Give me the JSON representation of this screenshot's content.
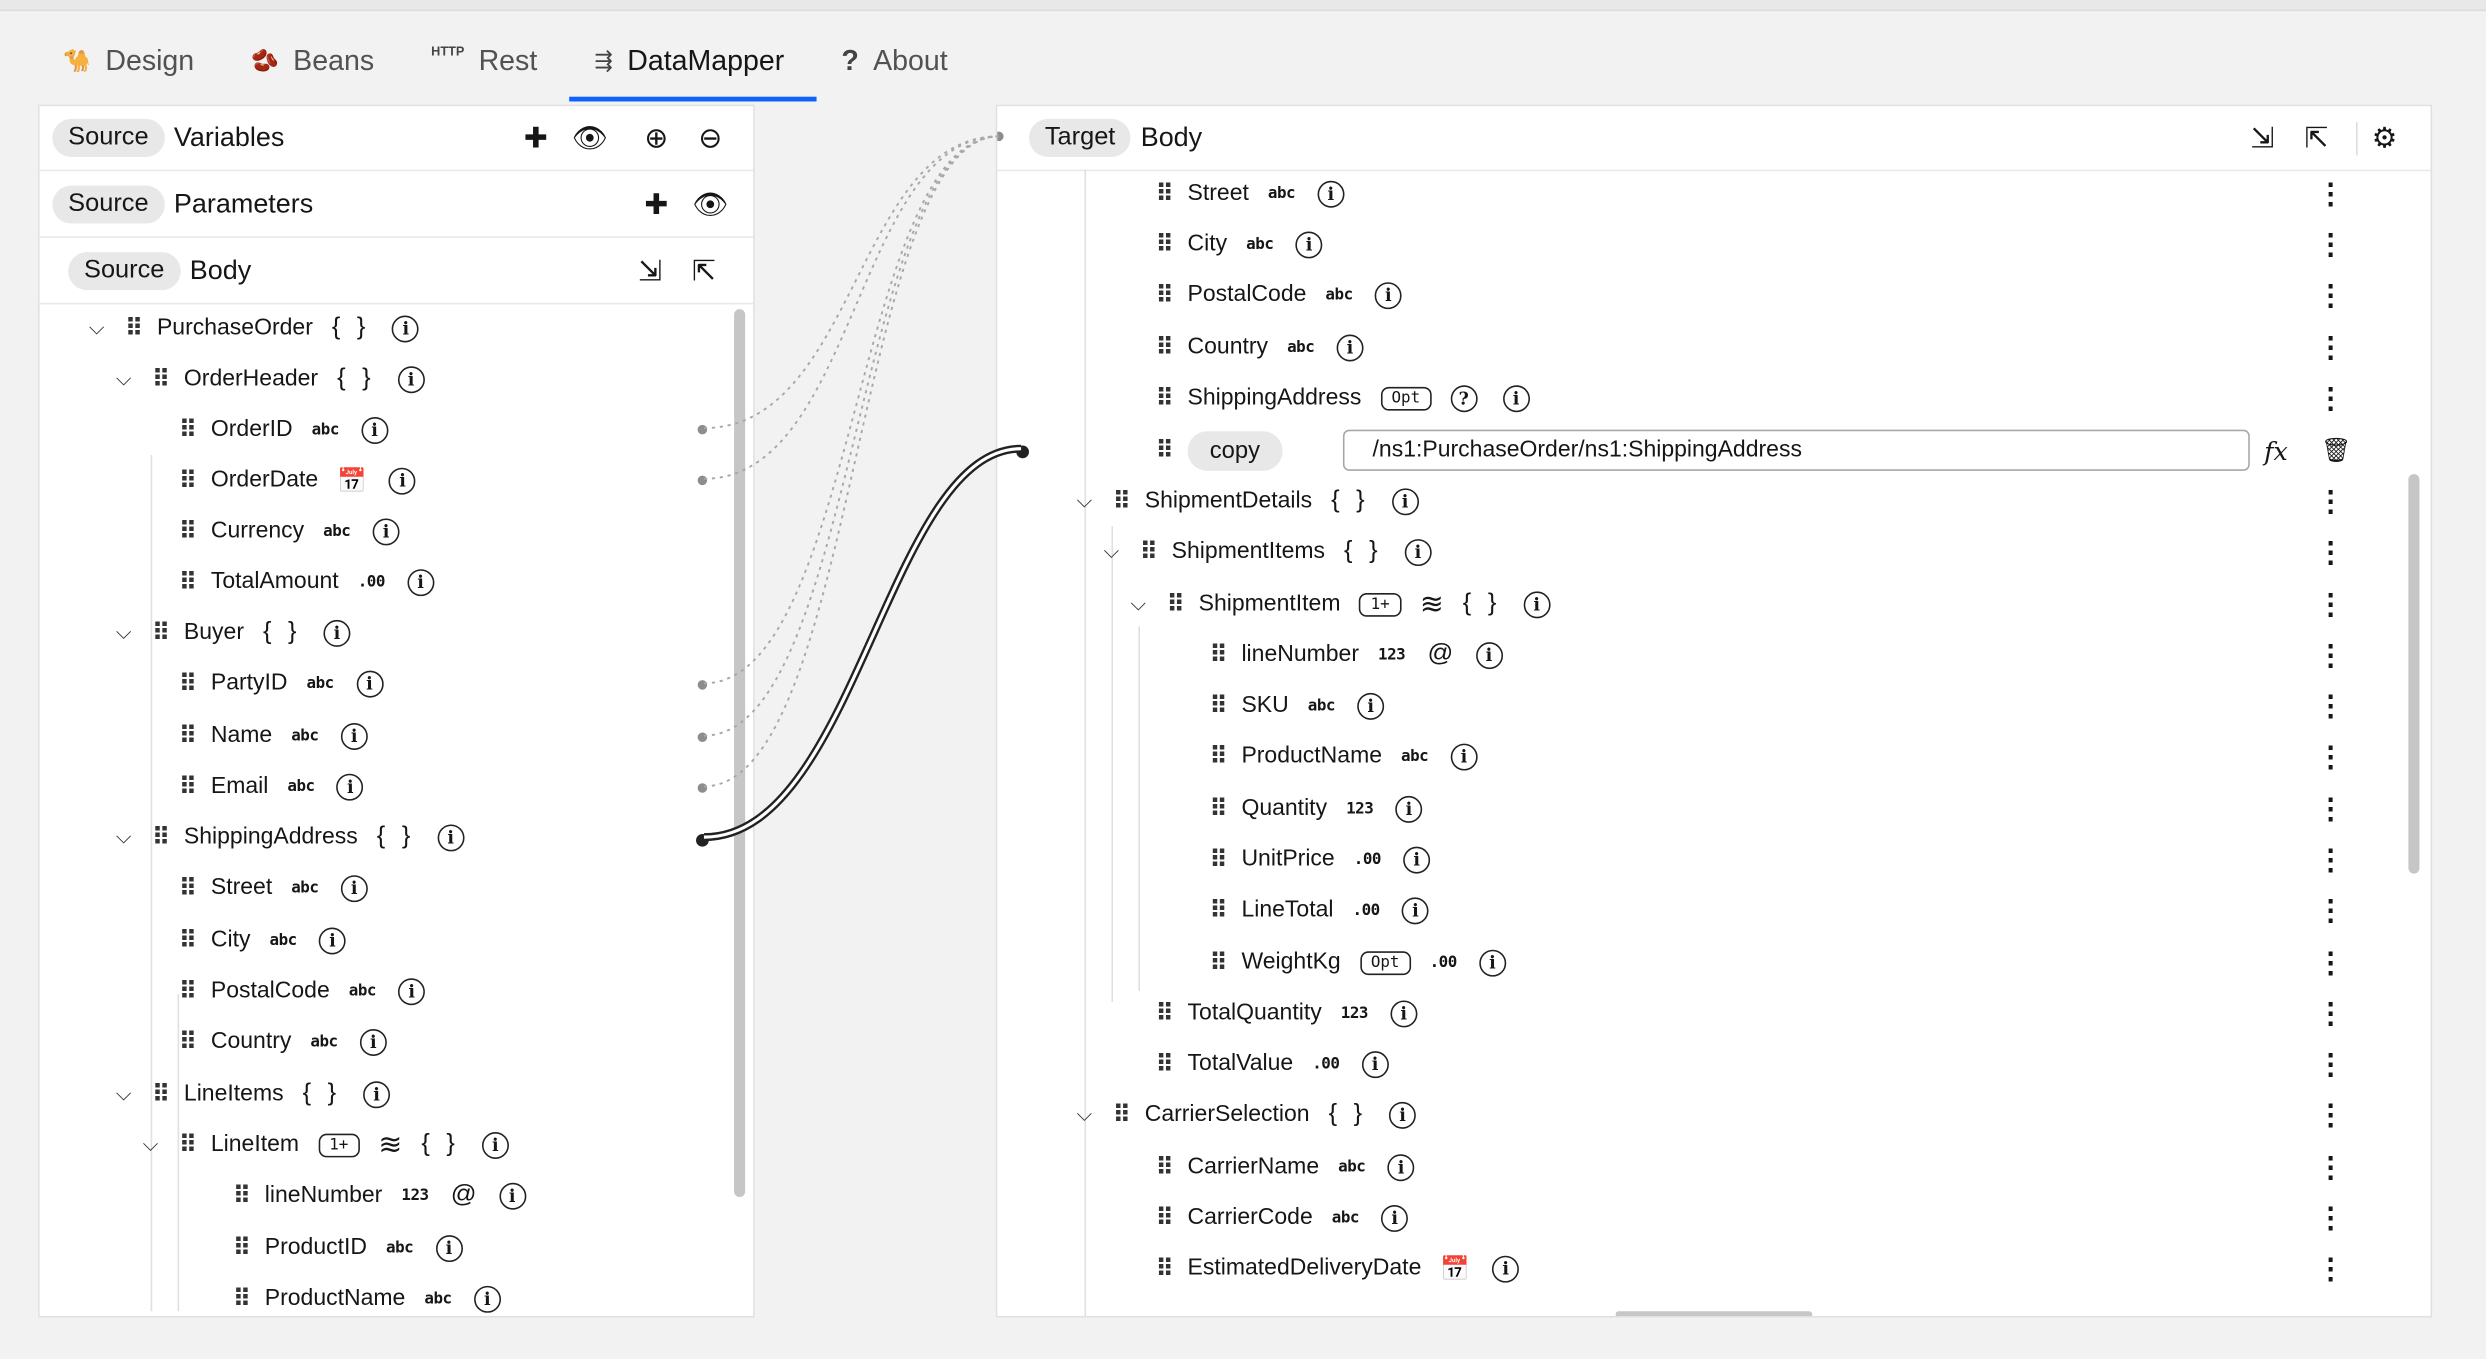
{
  "tabs": [
    {
      "label": "Design",
      "icon": "camel-icon"
    },
    {
      "label": "Beans",
      "icon": "bean-icon"
    },
    {
      "label": "Rest",
      "icon": "http-icon",
      "icon_text": "HTTP"
    },
    {
      "label": "DataMapper",
      "icon": "mapper-icon",
      "active": true
    },
    {
      "label": "About",
      "icon": "question-icon",
      "icon_text": "?"
    }
  ],
  "source": {
    "variables": {
      "tag": "Source",
      "title": "Variables"
    },
    "parameters": {
      "tag": "Source",
      "title": "Parameters"
    },
    "body": {
      "tag": "Source",
      "title": "Body"
    },
    "tree": [
      {
        "label": "PurchaseOrder",
        "type": "{ }"
      },
      {
        "label": "OrderHeader",
        "type": "{ }"
      },
      {
        "label": "OrderID",
        "type": "abc"
      },
      {
        "label": "OrderDate",
        "type": "date"
      },
      {
        "label": "Currency",
        "type": "abc"
      },
      {
        "label": "TotalAmount",
        "type": ".00"
      },
      {
        "label": "Buyer",
        "type": "{ }"
      },
      {
        "label": "PartyID",
        "type": "abc"
      },
      {
        "label": "Name",
        "type": "abc"
      },
      {
        "label": "Email",
        "type": "abc"
      },
      {
        "label": "ShippingAddress",
        "type": "{ }"
      },
      {
        "label": "Street",
        "type": "abc"
      },
      {
        "label": "City",
        "type": "abc"
      },
      {
        "label": "PostalCode",
        "type": "abc"
      },
      {
        "label": "Country",
        "type": "abc"
      },
      {
        "label": "LineItems",
        "type": "{ }"
      },
      {
        "label": "LineItem",
        "badge": "1+",
        "type": "{ }"
      },
      {
        "label": "lineNumber",
        "type": "123"
      },
      {
        "label": "ProductID",
        "type": "abc"
      },
      {
        "label": "ProductName",
        "type": "abc"
      }
    ]
  },
  "target": {
    "body": {
      "tag": "Target",
      "title": "Body"
    },
    "tree": [
      {
        "label": "Street",
        "type": "abc"
      },
      {
        "label": "City",
        "type": "abc"
      },
      {
        "label": "PostalCode",
        "type": "abc"
      },
      {
        "label": "Country",
        "type": "abc"
      },
      {
        "label": "ShippingAddress",
        "badge": "Opt"
      },
      {
        "label": "copy",
        "xpath": "/ns1:PurchaseOrder/ns1:ShippingAddress"
      },
      {
        "label": "ShipmentDetails",
        "type": "{ }"
      },
      {
        "label": "ShipmentItems",
        "type": "{ }"
      },
      {
        "label": "ShipmentItem",
        "badge": "1+",
        "type": "{ }"
      },
      {
        "label": "lineNumber",
        "type": "123"
      },
      {
        "label": "SKU",
        "type": "abc"
      },
      {
        "label": "ProductName",
        "type": "abc"
      },
      {
        "label": "Quantity",
        "type": "123"
      },
      {
        "label": "UnitPrice",
        "type": ".00"
      },
      {
        "label": "LineTotal",
        "type": ".00"
      },
      {
        "label": "WeightKg",
        "badge": "Opt",
        "type": ".00"
      },
      {
        "label": "TotalQuantity",
        "type": "123"
      },
      {
        "label": "TotalValue",
        "type": ".00"
      },
      {
        "label": "CarrierSelection",
        "type": "{ }"
      },
      {
        "label": "CarrierName",
        "type": "abc"
      },
      {
        "label": "CarrierCode",
        "type": "abc"
      },
      {
        "label": "EstimatedDeliveryDate",
        "type": "calendar"
      }
    ]
  },
  "colors": {
    "accent": "#0f62fe",
    "link": "#222222",
    "dashed": "#a8a8a8"
  }
}
